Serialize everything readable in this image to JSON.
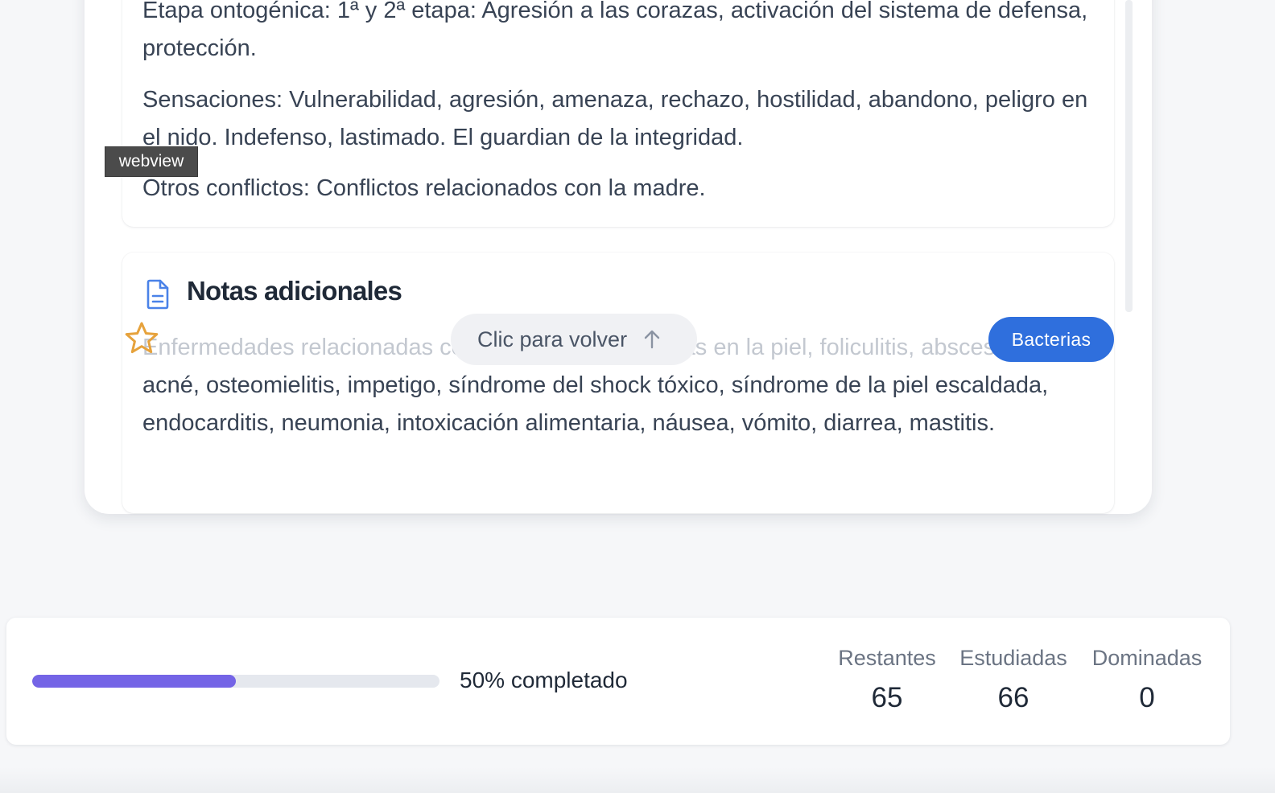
{
  "card": {
    "paragraphs": [
      "Etapa ontogénica: 1ª y 2ª etapa: Agresión a las corazas, activación del sistema de defensa, protección.",
      "Sensaciones: Vulnerabilidad, agresión, amenaza, rechazo, hostilidad, abandono, peligro en el nido. Indefenso, lastimado. El guardian de la integridad.",
      "Otros conflictos: Conflictos relacionados con la madre."
    ],
    "notes": {
      "title": "Notas adicionales",
      "text_first_line": "Enfermedades relacionadas con infecciones causadas en la piel, foliculitis, abscesos,",
      "text_rest": "acné, osteomielitis, impetigo, síndrome del shock tóxico, síndrome de la piel escaldada, endocarditis, neumonia, intoxicación alimentaria, náusea, vómito, diarrea, mastitis."
    },
    "flip_back_label": "Clic para volver",
    "category_badge": "Bacterias",
    "icons": {
      "notes": "document-icon",
      "favorite": "star-icon",
      "flip": "arrow-up-icon"
    }
  },
  "debug_tag": "webview",
  "progress": {
    "percent": 50,
    "label": "50% completado",
    "stats": [
      {
        "label": "Restantes",
        "value": "65"
      },
      {
        "label": "Estudiadas",
        "value": "66"
      },
      {
        "label": "Dominadas",
        "value": "0"
      }
    ]
  },
  "colors": {
    "accent_progress": "#7464e6",
    "badge_blue": "#2f6fdd",
    "star_orange": "#e6a23c",
    "doc_icon_blue": "#4a82e8"
  }
}
